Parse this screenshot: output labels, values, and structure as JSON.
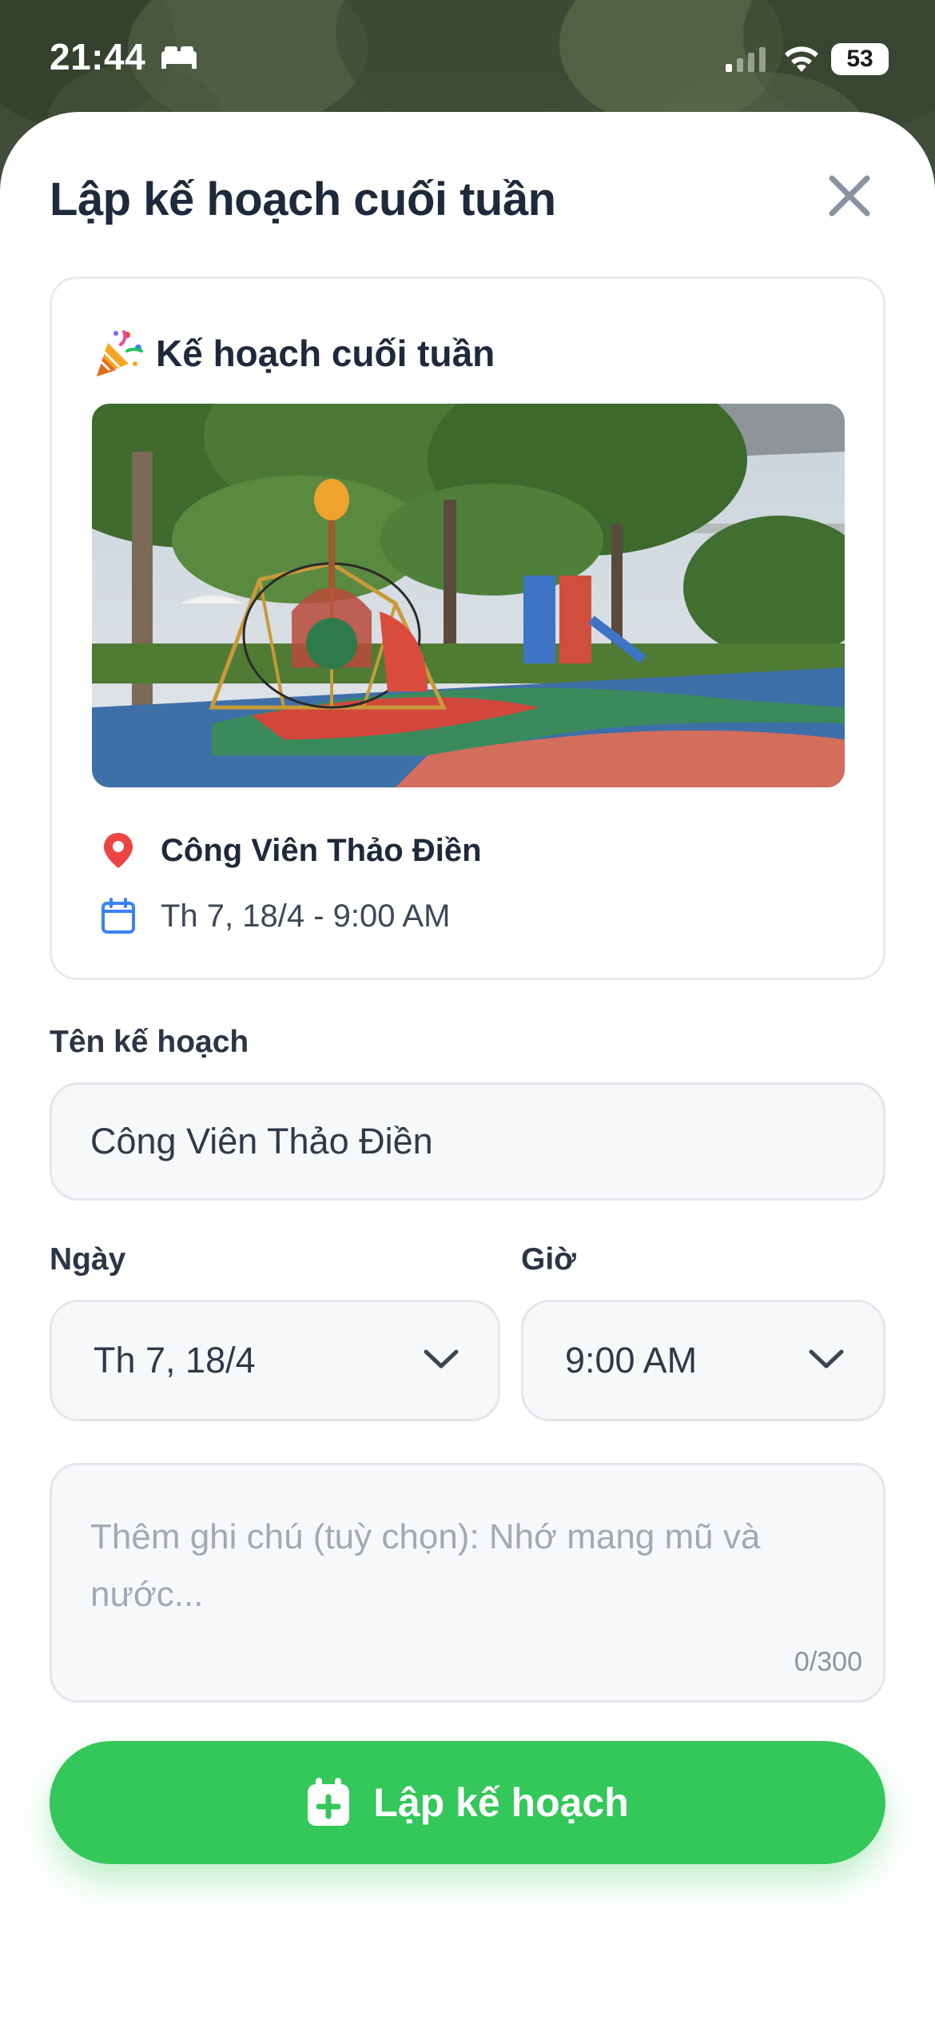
{
  "status_bar": {
    "time": "21:44",
    "battery": "53"
  },
  "sheet": {
    "title": "Lập kế hoạch cuối tuần",
    "close_icon": "close-icon"
  },
  "card": {
    "title": "Kế hoạch cuối tuần",
    "title_icon": "party-popper-icon",
    "photo": "playground-photo",
    "place": "Công Viên Thảo Điền",
    "datetime": "Th 7, 18/4 - 9:00 AM"
  },
  "form": {
    "name_label": "Tên kế hoạch",
    "name_value": "Công Viên Thảo Điền",
    "date_label": "Ngày",
    "date_value": "Th 7, 18/4",
    "time_label": "Giờ",
    "time_value": "9:00 AM",
    "notes_placeholder": "Thêm ghi chú (tuỳ chọn): Nhớ mang mũ và nước...",
    "notes_counter": "0/300"
  },
  "cta": {
    "label": "Lập kế hoạch",
    "icon": "calendar-plus-icon"
  },
  "colors": {
    "primary_green": "#34c759",
    "text_dark": "#1e2a3b",
    "pin_red": "#ef4444",
    "calendar_blue": "#3b82f6"
  }
}
